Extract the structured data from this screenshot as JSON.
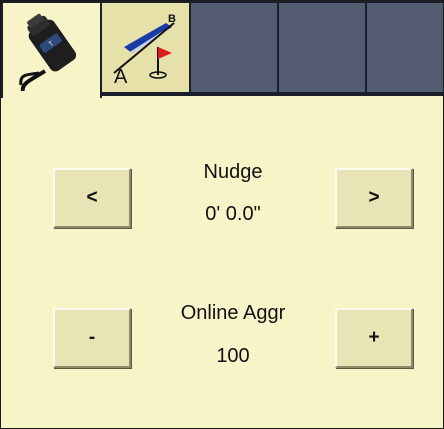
{
  "tabs": [
    {
      "name": "guidance",
      "icon": "gps-receiver-icon",
      "active": true
    },
    {
      "name": "ab-line",
      "icon": "ab-line-flag-icon",
      "active": false
    },
    {
      "name": "empty-1",
      "active": false
    },
    {
      "name": "empty-2",
      "active": false
    },
    {
      "name": "empty-3",
      "active": false
    }
  ],
  "nudge": {
    "title": "Nudge",
    "value": "0' 0.0\"",
    "left_label": "<",
    "right_label": ">"
  },
  "online_aggr": {
    "title": "Online Aggr",
    "value": "100",
    "minus_label": "-",
    "plus_label": "+"
  },
  "ab_icon_letters": {
    "a": "A",
    "b": "B"
  },
  "receiver_logo_text": "T",
  "colors": {
    "background": "#f7f4c8",
    "tab_inactive": "#545c72",
    "button_face": "#e8e4b6",
    "flag_red": "#e01b1b",
    "line_blue": "#1a3aa8"
  }
}
